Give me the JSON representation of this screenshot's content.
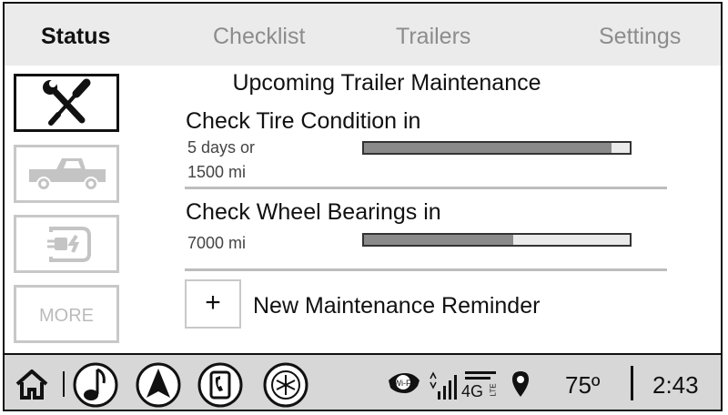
{
  "tabs": [
    {
      "label": "Status",
      "active": true
    },
    {
      "label": "Checklist",
      "active": false
    },
    {
      "label": "Trailers",
      "active": false
    },
    {
      "label": "Settings",
      "active": false
    }
  ],
  "sidebar": {
    "items": [
      {
        "icon": "wrench-screwdriver-icon",
        "active": true
      },
      {
        "icon": "pickup-truck-icon",
        "active": false
      },
      {
        "icon": "trailer-plug-icon",
        "active": false
      },
      {
        "label": "MORE",
        "active": false
      }
    ]
  },
  "main": {
    "title": "Upcoming Trailer Maintenance",
    "items": [
      {
        "title": "Check Tire Condition in",
        "detail_lines": [
          "5 days or",
          "1500 mi"
        ],
        "progress": 0.93
      },
      {
        "title": "Check Wheel Bearings in",
        "detail_lines": [
          "7000 mi"
        ],
        "progress": 0.56
      }
    ],
    "add_reminder": {
      "symbol": "+",
      "label": "New Maintenance Reminder"
    }
  },
  "status_bar": {
    "icons": [
      "home-icon",
      "music-note-icon",
      "navigation-arrow-icon",
      "phone-icon",
      "climate-fan-icon",
      "wifi-icon",
      "signal-4g-lte-icon",
      "location-pin-icon"
    ],
    "wifi_label": "Wi-Fi",
    "network_label": "4G",
    "lte_label": "LTE",
    "temperature": "75º",
    "time": "2:43"
  },
  "colors": {
    "tabbar_bg": "#ebebeb",
    "bottombar_bg": "#d7d7d7",
    "bar_fill": "#8a8a8a",
    "bar_empty": "#eaeaea"
  }
}
